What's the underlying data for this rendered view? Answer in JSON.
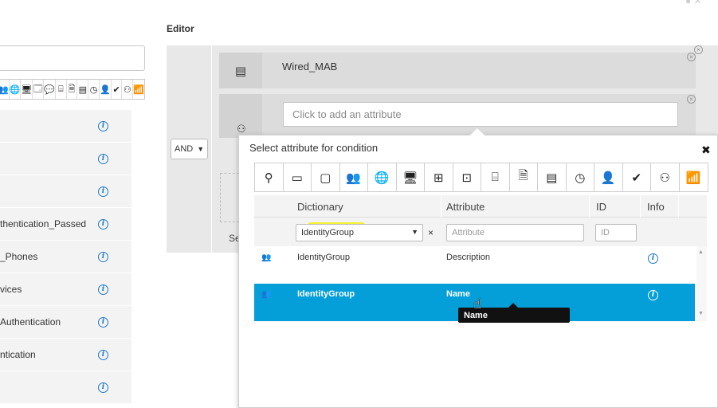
{
  "left_panel": {
    "icons": [
      "location-pin-icon",
      "certificate-icon",
      "square-icon",
      "group-icon",
      "globe-icon",
      "monitor-icon",
      "windows-monitor-icon",
      "endpoint-icon",
      "router-icon",
      "document-icon",
      "server-icon",
      "clock-icon",
      "user-icon",
      "checkmark-circle-icon",
      "hierarchy-icon",
      "wifi-icon"
    ],
    "icon_glyphs": [
      "📍",
      "🪪",
      "▢",
      "👥",
      "🌐",
      "🖥",
      "🗔",
      "💬",
      "⌸",
      "🗎",
      "▤",
      "◷",
      "👤",
      "✔",
      "⚇",
      "📶"
    ],
    "rows": [
      {
        "label": ""
      },
      {
        "label": ""
      },
      {
        "label": ""
      },
      {
        "label": "thentication_Passed"
      },
      {
        "label": "_Phones"
      },
      {
        "label": "vices"
      },
      {
        "label": "Authentication"
      },
      {
        "label": "ntication"
      },
      {
        "label": ""
      }
    ],
    "info_glyph": "i"
  },
  "editor": {
    "title": "Editor",
    "operator": "AND",
    "condition1": {
      "icon": "server-icon",
      "glyph": "▤",
      "label": "Wired_MAB"
    },
    "condition2": {
      "placeholder": "Click to add an attribute",
      "icon": "hierarchy-icon",
      "glyph": "⚇"
    },
    "footer_text": "Se"
  },
  "popup": {
    "title": "Select attribute for condition",
    "close_glyph": "✖",
    "icon_tabs": [
      {
        "name": "location-pin-icon",
        "glyph": "⚲"
      },
      {
        "name": "certificate-icon",
        "glyph": "▭"
      },
      {
        "name": "square-icon",
        "glyph": "▢"
      },
      {
        "name": "group-icon",
        "glyph": "👥"
      },
      {
        "name": "globe-icon",
        "glyph": "🌐"
      },
      {
        "name": "monitor-icon",
        "glyph": "🖥"
      },
      {
        "name": "windows-monitor-icon",
        "glyph": "⊞"
      },
      {
        "name": "endpoint-icon",
        "glyph": "⊡"
      },
      {
        "name": "router-icon",
        "glyph": "⌸"
      },
      {
        "name": "document-icon",
        "glyph": "🗎"
      },
      {
        "name": "server-icon",
        "glyph": "▤"
      },
      {
        "name": "clock-icon",
        "glyph": "◷"
      },
      {
        "name": "user-icon",
        "glyph": "👤"
      },
      {
        "name": "checkmark-circle-icon",
        "glyph": "✔"
      },
      {
        "name": "hierarchy-icon",
        "glyph": "⚇"
      },
      {
        "name": "wifi-icon",
        "glyph": "📶"
      }
    ],
    "columns": {
      "dictionary": "Dictionary",
      "attribute": "Attribute",
      "id": "ID",
      "info": "Info"
    },
    "filters": {
      "dictionary_value": "IdentityGroup",
      "clear_glyph": "×",
      "attribute_placeholder": "Attribute",
      "id_placeholder": "ID"
    },
    "rows": [
      {
        "dictionary": "IdentityGroup",
        "attribute": "Description",
        "selected": false
      },
      {
        "dictionary": "IdentityGroup",
        "attribute": "Name",
        "selected": true
      }
    ],
    "tooltip": "Name"
  },
  "colors": {
    "selected_row": "#049fd9",
    "info_blue": "#1f7ac7",
    "highlight": "#f4f01a"
  }
}
